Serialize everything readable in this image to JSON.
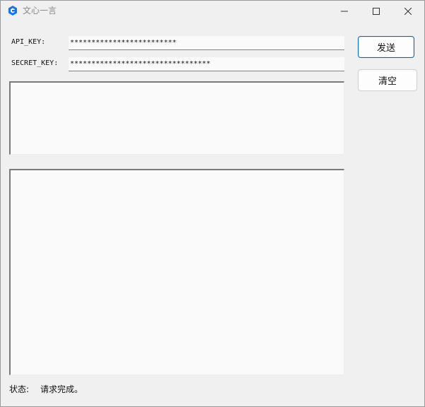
{
  "window": {
    "title": "文心一言",
    "app_icon": "hexagon-app-icon",
    "controls": {
      "minimize": "minimize-icon",
      "maximize": "maximize-icon",
      "close": "close-icon"
    }
  },
  "form": {
    "api_key_label": "API_KEY:",
    "api_key_value": "*************************",
    "secret_key_label": "SECRET_KEY:",
    "secret_key_value": "*********************************"
  },
  "buttons": {
    "send_label": "发送",
    "clear_label": "清空"
  },
  "input_area": {
    "value": ""
  },
  "output_area": {
    "value": ""
  },
  "status": {
    "label": "状态:",
    "text": "请求完成。"
  },
  "colors": {
    "accent": "#0067c0",
    "icon_blue": "#1a73e8",
    "window_bg": "#f0f0f0",
    "field_bg": "#fafafa"
  }
}
